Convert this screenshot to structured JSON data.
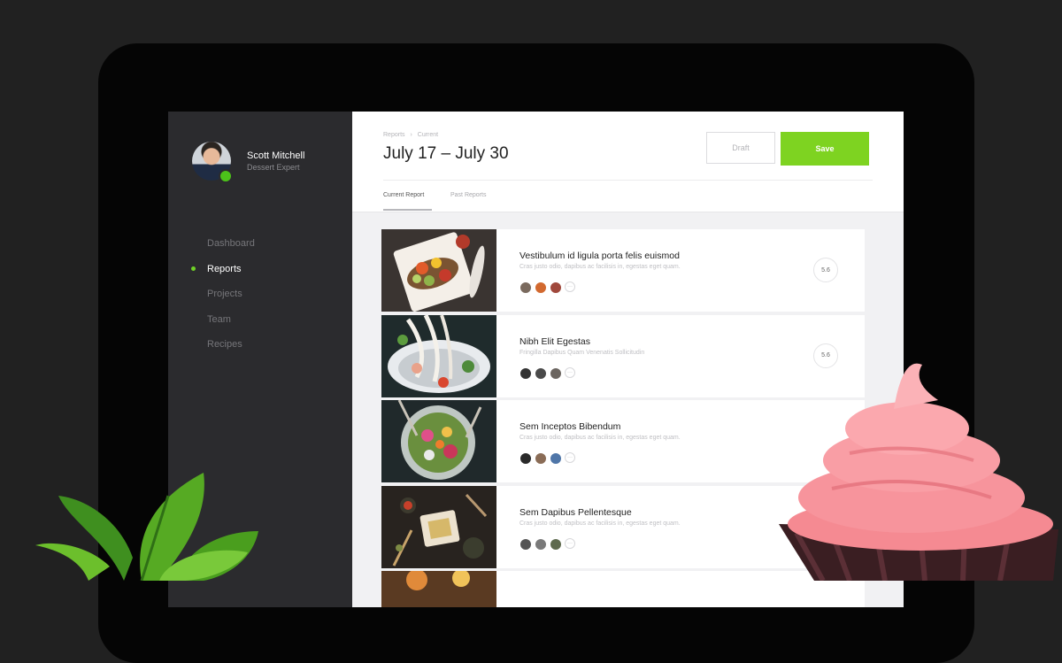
{
  "user": {
    "name": "Scott Mitchell",
    "role": "Dessert Expert"
  },
  "nav": {
    "items": [
      {
        "label": "Dashboard",
        "active": false
      },
      {
        "label": "Reports",
        "active": true
      },
      {
        "label": "Projects",
        "active": false
      },
      {
        "label": "Team",
        "active": false
      },
      {
        "label": "Recipes",
        "active": false
      }
    ]
  },
  "header": {
    "breadcrumb": [
      "Reports",
      "Current"
    ],
    "breadcrumb_sep": "›",
    "title": "July 17 – July 30",
    "draft_label": "Draft",
    "save_label": "Save",
    "tabs": [
      "Current Report",
      "Past Reports"
    ]
  },
  "reports": [
    {
      "title": "Vestibulum id ligula porta felis euismod",
      "subtitle": "Cras justo odio, dapibus ac facilisis in, egestas eget quam.",
      "score": "5.6"
    },
    {
      "title": "Nibh Elit Egestas",
      "subtitle": "Fringilla Dapibus Quam Venenatis Sollicitudin",
      "score": "5.6"
    },
    {
      "title": "Sem Inceptos Bibendum",
      "subtitle": "Cras justo odio, dapibus ac facilisis in, egestas eget quam.",
      "score": ""
    },
    {
      "title": "Sem Dapibus Pellentesque",
      "subtitle": "Cras justo odio, dapibus ac facilisis in, egestas eget quam.",
      "score": ""
    }
  ],
  "more_glyph": "···",
  "colors": {
    "accent": "#7ed321",
    "sidebar": "#2b2b2e",
    "background": "#212121"
  }
}
